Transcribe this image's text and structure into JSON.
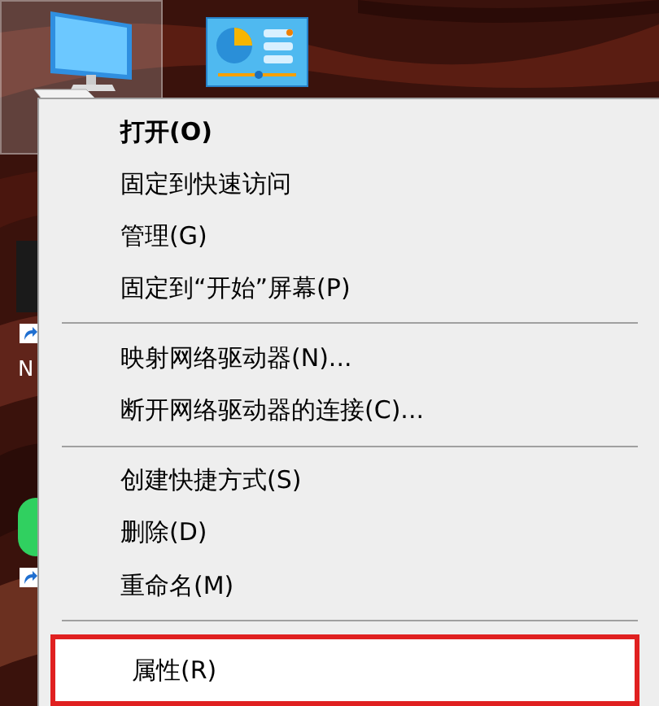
{
  "desktop": {
    "icons": [
      {
        "kind": "computer",
        "selected": true
      },
      {
        "kind": "control-panel",
        "selected": false
      }
    ],
    "partial_label": "N"
  },
  "context_menu": {
    "items": [
      {
        "kind": "item",
        "label": "打开(O)",
        "bold": true,
        "selected": false,
        "outlined": false
      },
      {
        "kind": "item",
        "label": "固定到快速访问",
        "bold": false,
        "selected": false,
        "outlined": false
      },
      {
        "kind": "item",
        "label": "管理(G)",
        "bold": false,
        "selected": false,
        "outlined": false
      },
      {
        "kind": "item",
        "label": "固定到“开始”屏幕(P)",
        "bold": false,
        "selected": false,
        "outlined": false
      },
      {
        "kind": "separator"
      },
      {
        "kind": "item",
        "label": "映射网络驱动器(N)...",
        "bold": false,
        "selected": false,
        "outlined": false
      },
      {
        "kind": "item",
        "label": "断开网络驱动器的连接(C)...",
        "bold": false,
        "selected": false,
        "outlined": false
      },
      {
        "kind": "separator"
      },
      {
        "kind": "item",
        "label": "创建快捷方式(S)",
        "bold": false,
        "selected": false,
        "outlined": false
      },
      {
        "kind": "item",
        "label": "删除(D)",
        "bold": false,
        "selected": false,
        "outlined": false
      },
      {
        "kind": "item",
        "label": "重命名(M)",
        "bold": false,
        "selected": false,
        "outlined": false
      },
      {
        "kind": "separator"
      },
      {
        "kind": "item",
        "label": "属性(R)",
        "bold": false,
        "selected": true,
        "outlined": true
      }
    ]
  }
}
